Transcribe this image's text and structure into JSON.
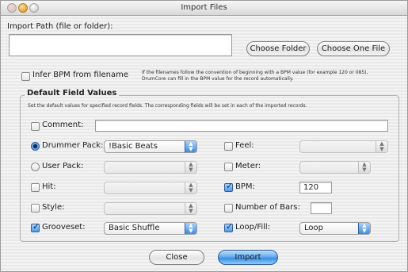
{
  "window": {
    "title": "Import Files"
  },
  "import_path": {
    "label": "Import Path (file or folder):",
    "value": ""
  },
  "buttons": {
    "choose_folder": "Choose Folder",
    "choose_file": "Choose One File",
    "close": "Close",
    "import": "Import"
  },
  "infer": {
    "label": "Infer BPM from filename",
    "checked": false,
    "help_line1": "If the filenames follow the convention of beginning with a BPM value (for example 120 or 085),",
    "help_line2": "DrumCore can fill in the BPM value for the record automatically."
  },
  "defaults": {
    "title": "Default Field Values",
    "description": "Set the default values for specified record fields. The corresponding fields will be set in each of the imported records.",
    "comment": {
      "label": "Comment:",
      "value": ""
    },
    "drummer_pack": {
      "label": "Drummer Pack:",
      "value": "!Basic Beats"
    },
    "user_pack": {
      "label": "User Pack:",
      "value": ""
    },
    "hit": {
      "label": "Hit:",
      "value": ""
    },
    "style": {
      "label": "Style:",
      "value": ""
    },
    "grooveset": {
      "label": "Grooveset:",
      "value": "Basic Shuffle"
    },
    "feel": {
      "label": "Feel:",
      "value": ""
    },
    "meter": {
      "label": "Meter:",
      "value": ""
    },
    "bpm": {
      "label": "BPM:",
      "value": "120"
    },
    "number_of_bars": {
      "label": "Number of Bars:",
      "value": ""
    },
    "loop_fill": {
      "label": "Loop/Fill:",
      "value": "Loop"
    }
  },
  "colors": {
    "accent": "#3b8be0"
  }
}
